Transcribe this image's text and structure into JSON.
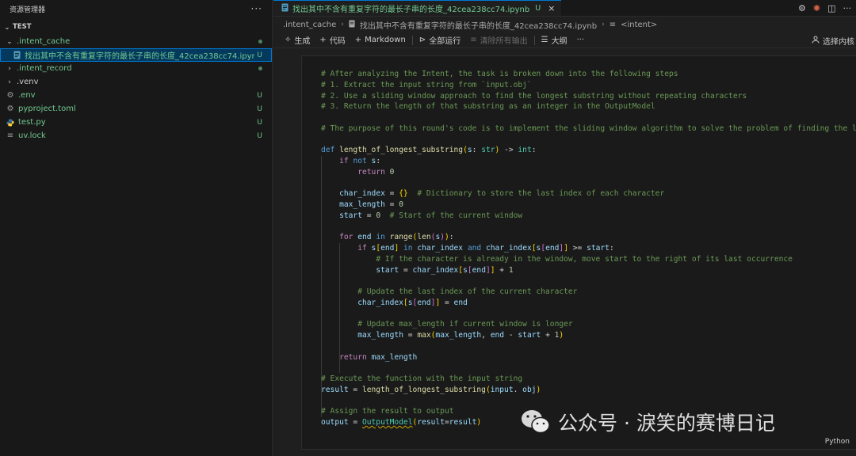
{
  "sidebar": {
    "header": "资源管理器",
    "more": "···",
    "section": "TEST",
    "items": [
      {
        "name": ".intent_cache",
        "type": "folder-open",
        "status": "dot"
      },
      {
        "name": "找出其中不含有重复字符的最长子串的长度_42cea238cc74.ipynb",
        "type": "notebook",
        "status": "U"
      },
      {
        "name": ".intent_record",
        "type": "folder",
        "status": "dot"
      },
      {
        "name": ".venv",
        "type": "folder",
        "status": ""
      },
      {
        "name": ".env",
        "type": "gear",
        "status": "U"
      },
      {
        "name": "pyproject.toml",
        "type": "gear",
        "status": "U"
      },
      {
        "name": "test.py",
        "type": "python",
        "status": "U"
      },
      {
        "name": "uv.lock",
        "type": "file",
        "status": "U"
      }
    ]
  },
  "tab": {
    "title": "找出其中不含有重复字符的最长子串的长度_42cea238cc74.ipynb",
    "status": "U",
    "close": "×"
  },
  "breadcrumb": {
    "folder": ".intent_cache",
    "file": "找出其中不含有重复字符的最长子串的长度_42cea238cc74.ipynb",
    "symbol": "<intent>"
  },
  "toolbar": {
    "generate": "生成",
    "code": "代码",
    "markdown": "Markdown",
    "run_all": "全部运行",
    "clear_outputs": "清除所有输出",
    "outline": "大纲",
    "more": "···",
    "select_kernel": "选择内核"
  },
  "cell": {
    "language": "Python"
  },
  "watermark": {
    "text": "公众号 · 淚笑的赛博日记"
  },
  "colors": {
    "accent": "#0078d4",
    "git_untracked": "#73c991",
    "comment": "#6a9955",
    "keyword": "#c586c0",
    "function": "#dcdcaa",
    "variable": "#9cdcfe"
  },
  "code_lines": [
    [
      [
        "cm",
        "# After analyzing the Intent, the task is broken down into the following steps"
      ]
    ],
    [
      [
        "cm",
        "# 1. Extract the input string from `input.obj`"
      ]
    ],
    [
      [
        "cm",
        "# 2. Use a sliding window approach to find the longest substring without repeating characters"
      ]
    ],
    [
      [
        "cm",
        "# 3. Return the length of that substring as an integer in the OutputModel"
      ]
    ],
    [],
    [
      [
        "cm",
        "# The purpose of this round's code is to implement the sliding window algorithm to solve the problem of finding the longest substring without repeating characters"
      ]
    ],
    [],
    [
      [
        "kw2",
        "def "
      ],
      [
        "fn",
        "length_of_longest_substring"
      ],
      [
        "br",
        "("
      ],
      [
        "vr",
        "s"
      ],
      [
        "",
        ": "
      ],
      [
        "ty",
        "str"
      ],
      [
        "br",
        ")"
      ],
      [
        "",
        " -> "
      ],
      [
        "ty",
        "int"
      ],
      [
        "",
        ":"
      ]
    ],
    [
      [
        "",
        "    "
      ],
      [
        "kw",
        "if "
      ],
      [
        "kw2",
        "not "
      ],
      [
        "vr",
        "s"
      ],
      [
        "",
        ":"
      ]
    ],
    [
      [
        "",
        "        "
      ],
      [
        "kw",
        "return "
      ],
      [
        "nm",
        "0"
      ]
    ],
    [],
    [
      [
        "",
        "    "
      ],
      [
        "vr",
        "char_index"
      ],
      [
        "",
        " = "
      ],
      [
        "br",
        "{}"
      ],
      [
        "",
        "  "
      ],
      [
        "cm",
        "# Dictionary to store the last index of each character"
      ]
    ],
    [
      [
        "",
        "    "
      ],
      [
        "vr",
        "max_length"
      ],
      [
        "",
        " = "
      ],
      [
        "nm",
        "0"
      ]
    ],
    [
      [
        "",
        "    "
      ],
      [
        "vr",
        "start"
      ],
      [
        "",
        " = "
      ],
      [
        "nm",
        "0"
      ],
      [
        "",
        "  "
      ],
      [
        "cm",
        "# Start of the current window"
      ]
    ],
    [],
    [
      [
        "",
        "    "
      ],
      [
        "kw",
        "for "
      ],
      [
        "vr",
        "end"
      ],
      [
        "kw2",
        " in "
      ],
      [
        "fn",
        "range"
      ],
      [
        "br",
        "("
      ],
      [
        "fn",
        "len"
      ],
      [
        "br2",
        "("
      ],
      [
        "vr",
        "s"
      ],
      [
        "br2",
        ")"
      ],
      [
        "br",
        ")"
      ],
      [
        "",
        ":"
      ]
    ],
    [
      [
        "",
        "        "
      ],
      [
        "kw",
        "if "
      ],
      [
        "vr",
        "s"
      ],
      [
        "br",
        "["
      ],
      [
        "vr",
        "end"
      ],
      [
        "br",
        "]"
      ],
      [
        "kw2",
        " in "
      ],
      [
        "vr",
        "char_index"
      ],
      [
        "kw2",
        " and "
      ],
      [
        "vr",
        "char_index"
      ],
      [
        "br",
        "["
      ],
      [
        "vr",
        "s"
      ],
      [
        "br2",
        "["
      ],
      [
        "vr",
        "end"
      ],
      [
        "br2",
        "]"
      ],
      [
        "br",
        "]"
      ],
      [
        "",
        " >= "
      ],
      [
        "vr",
        "start"
      ],
      [
        "",
        ":"
      ]
    ],
    [
      [
        "",
        "            "
      ],
      [
        "cm",
        "# If the character is already in the window, move start to the right of its last occurrence"
      ]
    ],
    [
      [
        "",
        "            "
      ],
      [
        "vr",
        "start"
      ],
      [
        "",
        " = "
      ],
      [
        "vr",
        "char_index"
      ],
      [
        "br",
        "["
      ],
      [
        "vr",
        "s"
      ],
      [
        "br2",
        "["
      ],
      [
        "vr",
        "end"
      ],
      [
        "br2",
        "]"
      ],
      [
        "br",
        "]"
      ],
      [
        "",
        " + "
      ],
      [
        "nm",
        "1"
      ]
    ],
    [],
    [
      [
        "",
        "        "
      ],
      [
        "cm",
        "# Update the last index of the current character"
      ]
    ],
    [
      [
        "",
        "        "
      ],
      [
        "vr",
        "char_index"
      ],
      [
        "br",
        "["
      ],
      [
        "vr",
        "s"
      ],
      [
        "br2",
        "["
      ],
      [
        "vr",
        "end"
      ],
      [
        "br2",
        "]"
      ],
      [
        "br",
        "]"
      ],
      [
        "",
        " = "
      ],
      [
        "vr",
        "end"
      ]
    ],
    [],
    [
      [
        "",
        "        "
      ],
      [
        "cm",
        "# Update max_length if current window is longer"
      ]
    ],
    [
      [
        "",
        "        "
      ],
      [
        "vr",
        "max_length"
      ],
      [
        "",
        " = "
      ],
      [
        "fn",
        "max"
      ],
      [
        "br",
        "("
      ],
      [
        "vr",
        "max_length"
      ],
      [
        "",
        ", "
      ],
      [
        "vr",
        "end"
      ],
      [
        "",
        " - "
      ],
      [
        "vr",
        "start"
      ],
      [
        "",
        " + "
      ],
      [
        "nm",
        "1"
      ],
      [
        "br",
        ")"
      ]
    ],
    [],
    [
      [
        "",
        "    "
      ],
      [
        "kw",
        "return "
      ],
      [
        "vr",
        "max_length"
      ]
    ],
    [],
    [
      [
        "cm",
        "# Execute the function with the input string"
      ]
    ],
    [
      [
        "vr",
        "result"
      ],
      [
        "",
        " = "
      ],
      [
        "fn",
        "length_of_longest_substring"
      ],
      [
        "br",
        "("
      ],
      [
        "vr",
        "input"
      ],
      [
        "",
        ". "
      ],
      [
        "vr",
        "obj"
      ],
      [
        "br",
        ")"
      ]
    ],
    [],
    [
      [
        "cm",
        "# Assign the result to output"
      ]
    ],
    [
      [
        "vr",
        "output"
      ],
      [
        "",
        " = "
      ],
      [
        "ty squig",
        "OutputModel"
      ],
      [
        "br",
        "("
      ],
      [
        "vr",
        "result"
      ],
      [
        "",
        "="
      ],
      [
        "vr",
        "result"
      ],
      [
        "br",
        ")"
      ]
    ]
  ]
}
